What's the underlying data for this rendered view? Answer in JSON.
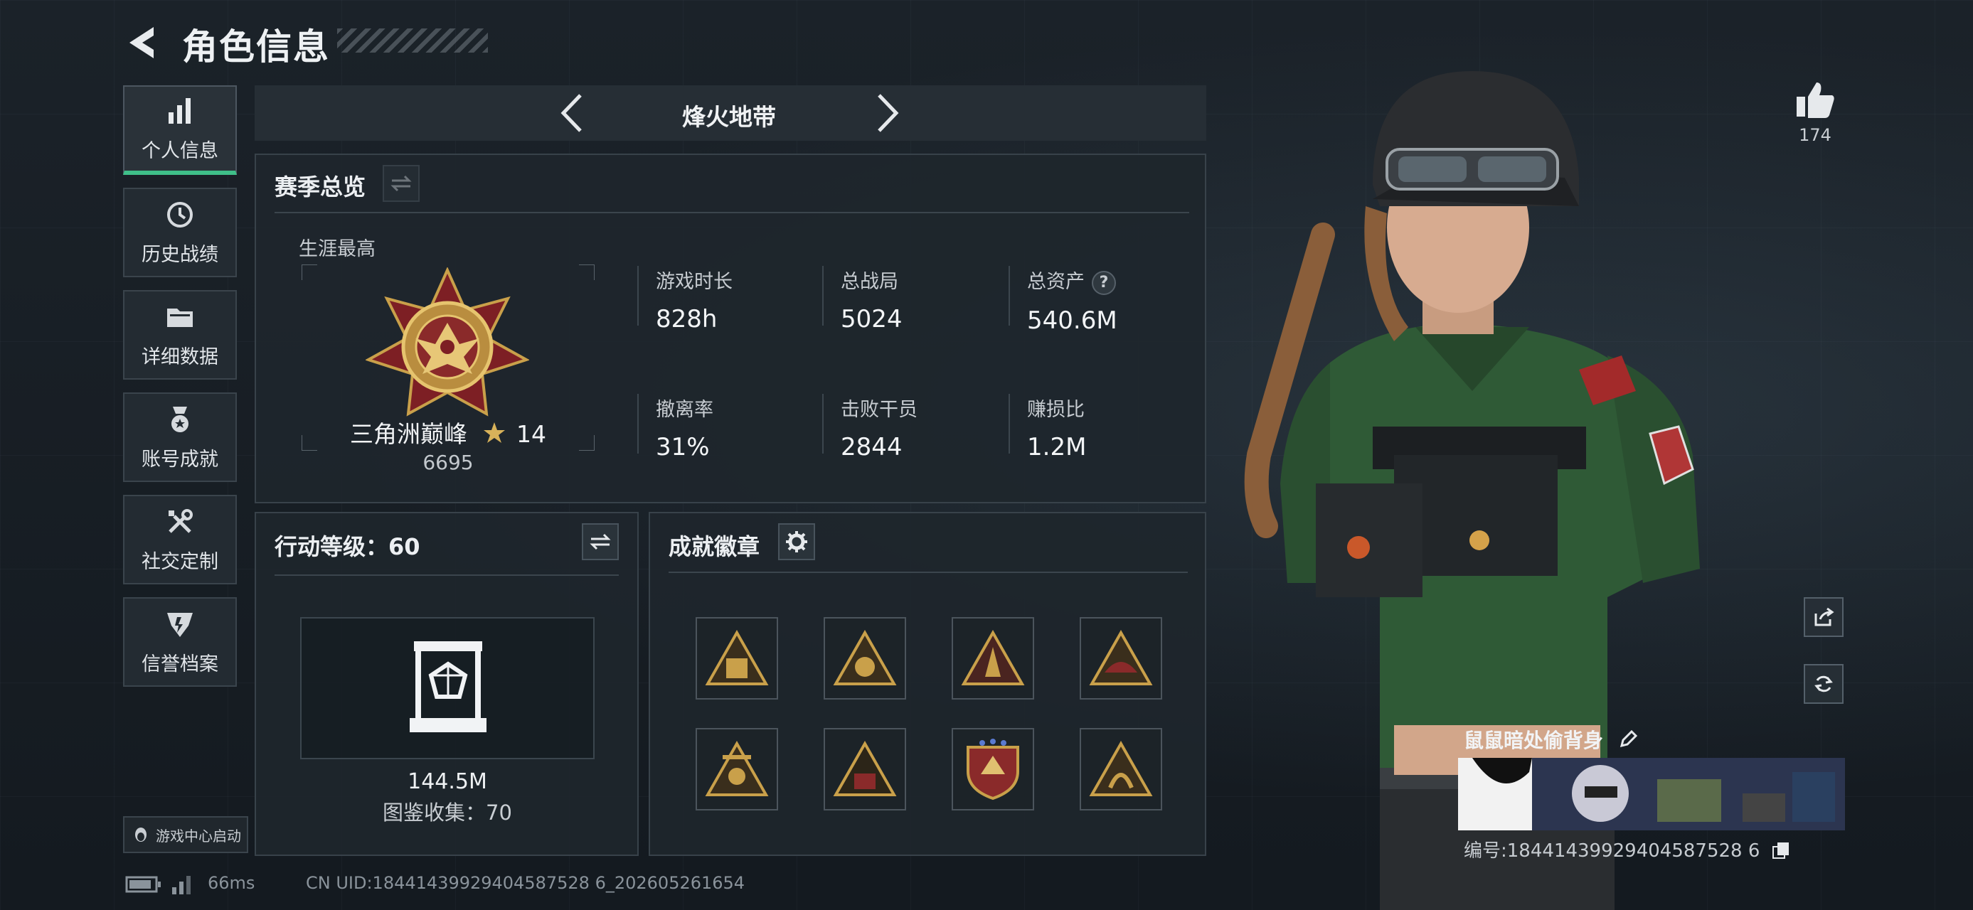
{
  "header": {
    "title": "角色信息"
  },
  "nav": {
    "items": [
      {
        "label": "个人信息",
        "icon": "bar-chart-icon",
        "active": true
      },
      {
        "label": "历史战绩",
        "icon": "history-clock-icon"
      },
      {
        "label": "详细数据",
        "icon": "folder-icon"
      },
      {
        "label": "账号成就",
        "icon": "medal-icon"
      },
      {
        "label": "社交定制",
        "icon": "wrench-screwdriver-icon"
      },
      {
        "label": "信誉档案",
        "icon": "credit-shield-icon"
      }
    ],
    "launch_label": "游戏中心启动"
  },
  "mode": {
    "label": "烽火地带"
  },
  "season": {
    "title": "赛季总览",
    "career_label": "生涯最高",
    "rank": {
      "name": "三角洲巅峰",
      "stars": "14",
      "score": "6695"
    },
    "stats": [
      {
        "label": "游戏时长",
        "value": "828h"
      },
      {
        "label": "总战局",
        "value": "5024"
      },
      {
        "label": "总资产",
        "value": "540.6M",
        "help": "?"
      },
      {
        "label": "撤离率",
        "value": "31%"
      },
      {
        "label": "击败干员",
        "value": "2844"
      },
      {
        "label": "赚损比",
        "value": "1.2M"
      }
    ]
  },
  "level": {
    "title": "行动等级：60",
    "collection_value": "144.5M",
    "collection_count": "图鉴收集：70"
  },
  "badges": {
    "title": "成就徽章",
    "items": [
      "badge-1",
      "badge-2",
      "badge-3",
      "badge-4",
      "badge-5",
      "badge-6",
      "badge-7",
      "badge-8"
    ]
  },
  "footer": {
    "latency": "66ms",
    "uid": "CN UID:18441439929404587528 6_202605261654"
  },
  "right": {
    "likes": "174",
    "background_name": "鼠鼠暗处偷背身",
    "serial": "编号:18441439929404587528 6"
  },
  "colors": {
    "accent": "#3fbf89",
    "gold": "#c9a04a"
  }
}
